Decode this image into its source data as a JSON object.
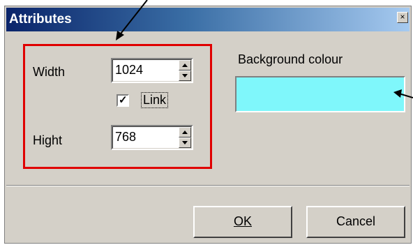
{
  "dialog": {
    "title": "Attributes",
    "close_label": "×"
  },
  "fields": {
    "width_label": "Width",
    "width_value": "1024",
    "link_label": "Link",
    "link_checked": true,
    "height_label": "Hight",
    "height_value": "768"
  },
  "background": {
    "label": "Background colour",
    "color": "#7ff7fb"
  },
  "buttons": {
    "ok_label": "OK",
    "cancel_label": "Cancel"
  },
  "colors": {
    "highlight_frame": "#e00000"
  }
}
